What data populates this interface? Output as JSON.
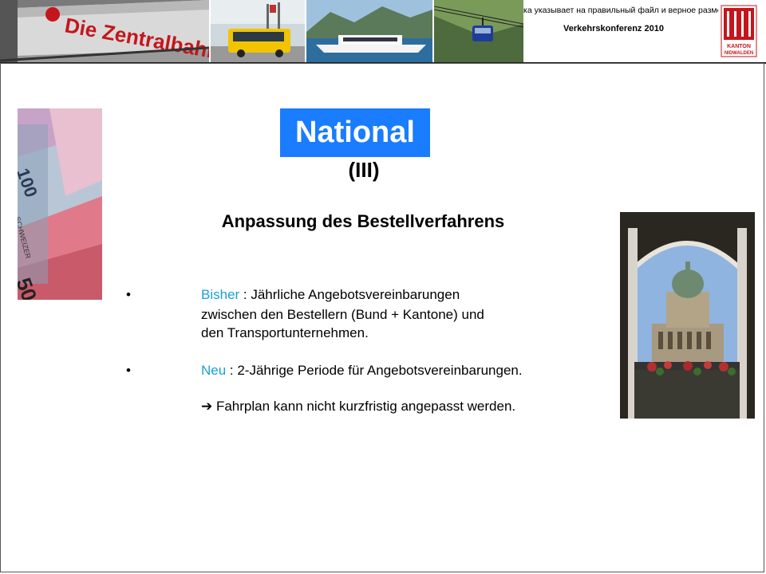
{
  "header": {
    "error_text": "ка указывает на правильный файл и верное размещ",
    "conference_title": "Verkehrskonferenz  2010",
    "photos": [
      {
        "name": "Die Zentralbahn train",
        "caption": "Die Zentralbahn."
      },
      {
        "name": "postbus"
      },
      {
        "name": "lake boat"
      },
      {
        "name": "cable car"
      }
    ],
    "logo": {
      "line1": "KANTON",
      "line2": "NIDWALDEN"
    }
  },
  "main": {
    "title": "National",
    "numeral": "(III)",
    "subtitle": "Anpassung des Bestellverfahrens",
    "bullets": [
      {
        "symbol": "•",
        "label": "Bisher",
        "label_suffix": " :  Jährliche Angebotsvereinbarungen",
        "lines": [
          "zwischen den Bestellern (Bund + Kantone) und",
          "den Transportunternehmen."
        ]
      },
      {
        "symbol": "•",
        "label": "Neu",
        "label_suffix": " : 2-Jährige Periode für Angebotsvereinbarungen."
      }
    ],
    "arrow_symbol": "➔",
    "arrow_text": " Fahrplan kann nicht kurzfristig angepasst werden."
  },
  "images": {
    "banknotes": {
      "values": [
        "100",
        "SCHWEIZER",
        "50"
      ]
    },
    "parliament": {}
  },
  "colors": {
    "title_bg": "#1a7cff",
    "label_cyan": "#19a0d8"
  }
}
